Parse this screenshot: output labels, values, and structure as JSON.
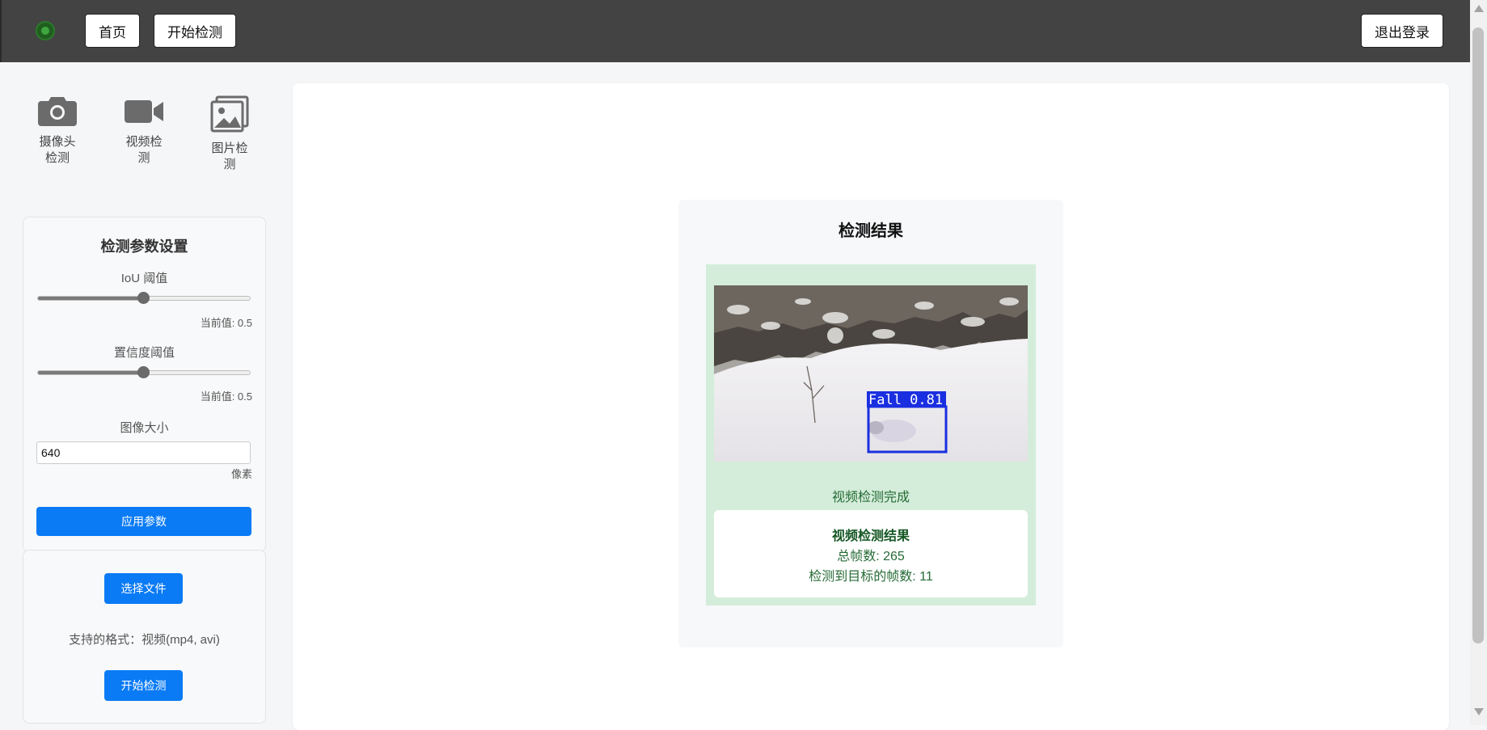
{
  "nav": {
    "home": "首页",
    "start_detect": "开始检测",
    "logout": "退出登录"
  },
  "modes": [
    {
      "icon": "camera-icon",
      "label": "摄像头\n检测"
    },
    {
      "icon": "video-icon",
      "label": "视频检\n测"
    },
    {
      "icon": "image-icon",
      "label": "图片检\n测"
    }
  ],
  "params": {
    "title": "检测参数设置",
    "iou_label": "IoU 阈值",
    "iou_current": "当前值: 0.5",
    "iou_value": 0.5,
    "conf_label": "置信度阈值",
    "conf_current": "当前值: 0.5",
    "conf_value": 0.5,
    "imgsize_label": "图像大小",
    "imgsize_value": "640",
    "imgsize_unit": "像素",
    "apply": "应用参数"
  },
  "upload": {
    "choose": "选择文件",
    "formats": "支持的格式：视频(mp4, avi)",
    "start": "开始检测"
  },
  "result": {
    "title": "检测结果",
    "detection_label": "Fall 0.81",
    "status": "视频检测完成",
    "card_title": "视频检测结果",
    "total_frames": "总帧数: 265",
    "frames_detected": "检测到目标的帧数: 11"
  },
  "colors": {
    "topbar": "#434343",
    "primary": "#0a7bf5",
    "success_bg": "#d4edda",
    "success_text": "#256b35",
    "bbox": "#1a2fe0"
  }
}
